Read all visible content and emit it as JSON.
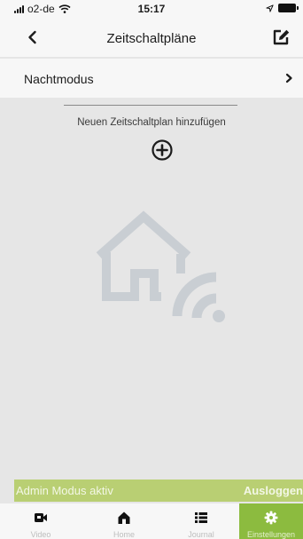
{
  "status_bar": {
    "carrier": "o2-de",
    "time": "15:17"
  },
  "nav": {
    "title": "Zeitschaltpläne"
  },
  "schedule": {
    "label": "Nachtmodus"
  },
  "add_schedule": {
    "label": "Neuen Zeitschaltplan hinzufügen"
  },
  "admin": {
    "status": "Admin Modus aktiv",
    "logout_label": "Ausloggen"
  },
  "tabs": [
    {
      "label": "Video",
      "icon": "video-camera-icon",
      "active": false
    },
    {
      "label": "Home",
      "icon": "home-icon",
      "active": false
    },
    {
      "label": "Journal",
      "icon": "list-icon",
      "active": false
    },
    {
      "label": "Einstellungen",
      "icon": "gear-icon",
      "active": true
    }
  ],
  "colors": {
    "accent": "#8cbb3f",
    "admin_bar": "#b9cf73",
    "background": "#e6e6e6",
    "bar": "#f7f7f7"
  }
}
